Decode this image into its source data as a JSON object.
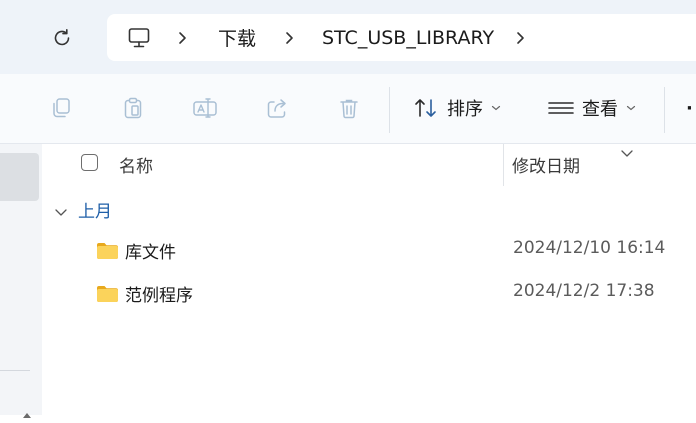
{
  "address_bar": {
    "segments": [
      "下载",
      "STC_USB_LIBRARY"
    ]
  },
  "toolbar": {
    "sort_label": "排序",
    "view_label": "查看",
    "more_label": "·"
  },
  "columns": {
    "name": "名称",
    "date_modified": "修改日期"
  },
  "group": {
    "label": "上月"
  },
  "files": [
    {
      "name": "库文件",
      "date": "2024/12/10 16:14",
      "type": "folder"
    },
    {
      "name": "范例程序",
      "date": "2024/12/2 17:38",
      "type": "folder"
    }
  ],
  "colors": {
    "accent": "#1f5fa8",
    "folder": "#f5c542",
    "topbar_bg": "#eef3f9"
  }
}
